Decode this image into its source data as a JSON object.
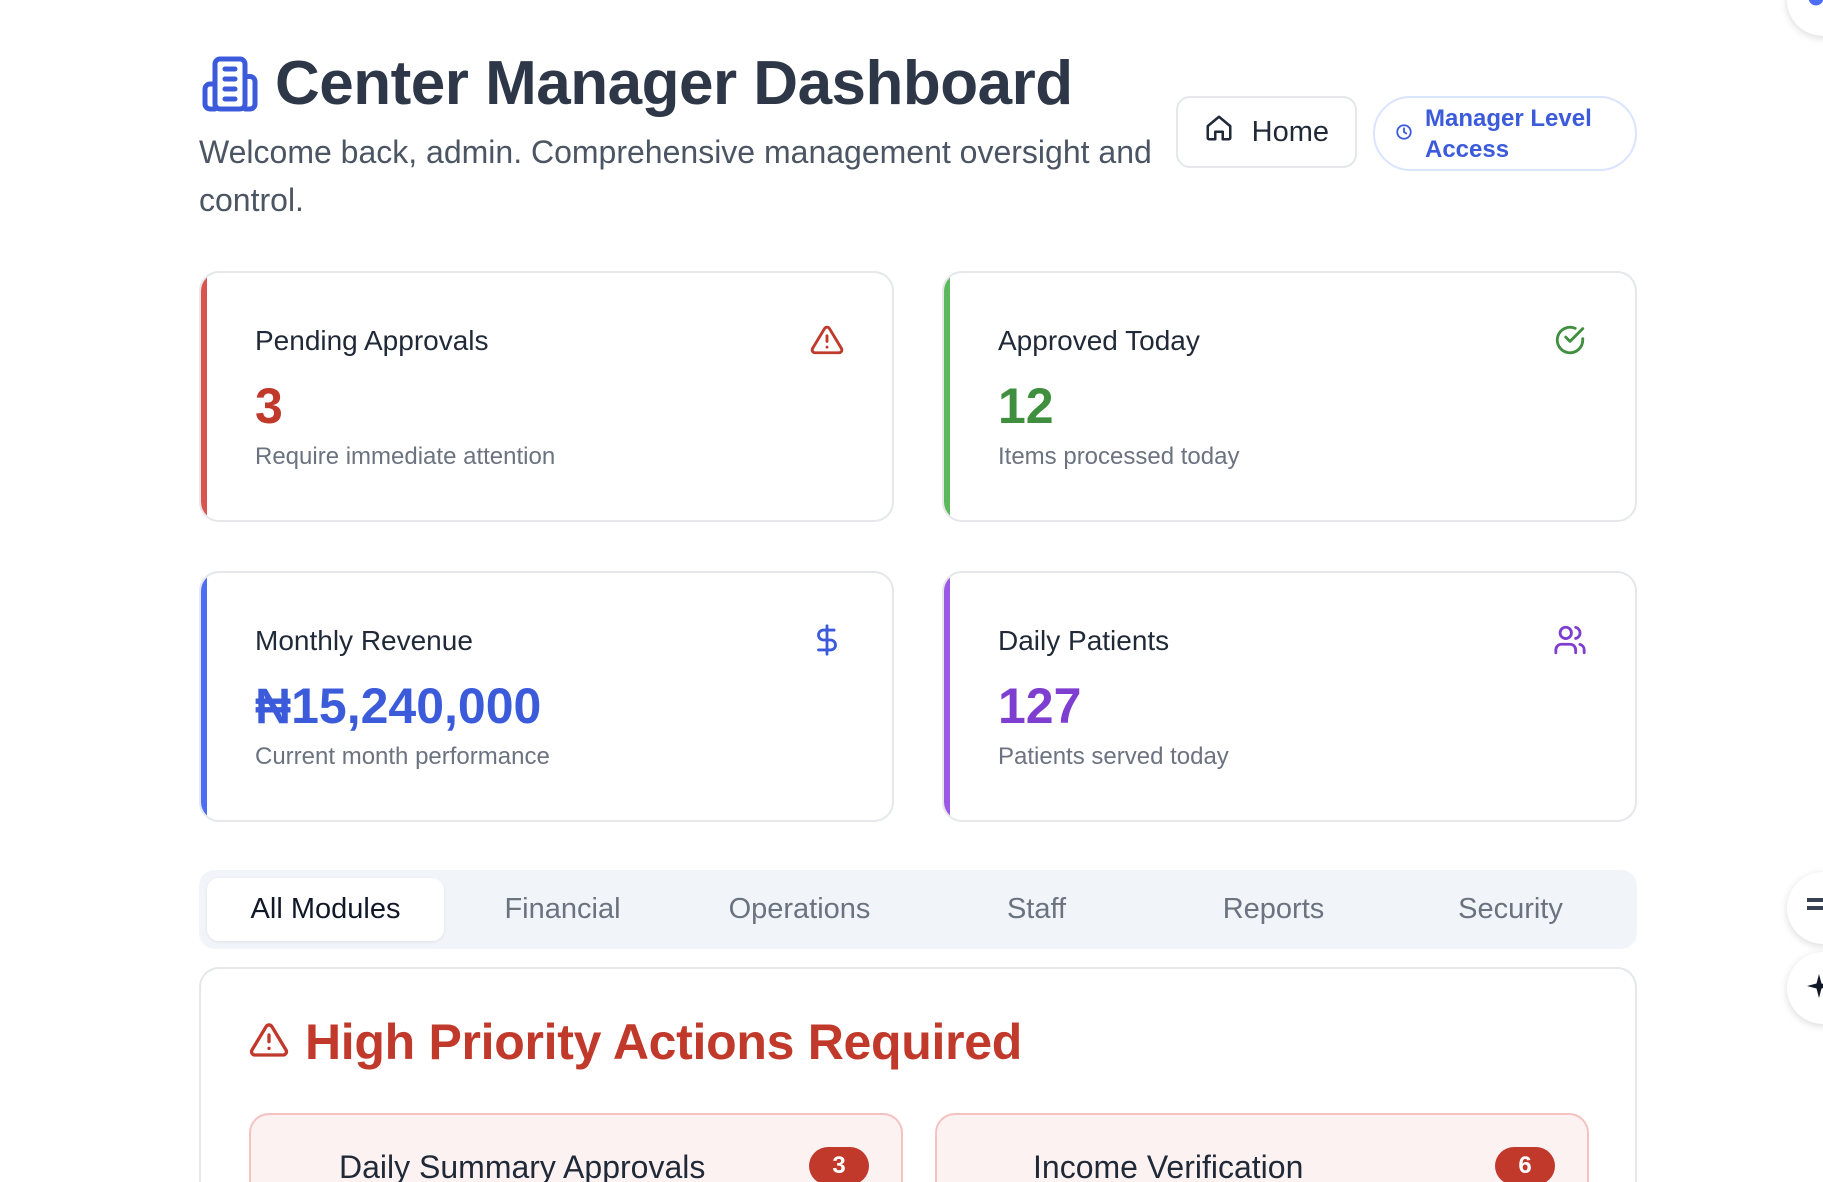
{
  "header": {
    "title": "Center Manager Dashboard",
    "subtitle": "Welcome back, admin. Comprehensive management oversight and control.",
    "home_label": "Home",
    "access_label": "Manager Level Access"
  },
  "stats": [
    {
      "label": "Pending Approvals",
      "value": "3",
      "sub": "Require immediate attention",
      "color": "#c0392b",
      "accent": "#d9534f",
      "icon": "warning-icon"
    },
    {
      "label": "Approved Today",
      "value": "12",
      "sub": "Items processed today",
      "color": "#3f8f3f",
      "accent": "#5cb85c",
      "icon": "check-circle-icon"
    },
    {
      "label": "Monthly Revenue",
      "value": "₦15,240,000",
      "sub": "Current month performance",
      "color": "#3b5bdb",
      "accent": "#4c6ef5",
      "icon": "dollar-icon"
    },
    {
      "label": "Daily Patients",
      "value": "127",
      "sub": "Patients served today",
      "color": "#7e3fd1",
      "accent": "#9b59e6",
      "icon": "users-icon"
    }
  ],
  "tabs": [
    "All Modules",
    "Financial",
    "Operations",
    "Staff",
    "Reports",
    "Security"
  ],
  "priority": {
    "title": "High Priority Actions Required",
    "actions": [
      {
        "name": "Daily Summary Approvals",
        "count": "3"
      },
      {
        "name": "Income Verification",
        "count": "6"
      }
    ]
  }
}
